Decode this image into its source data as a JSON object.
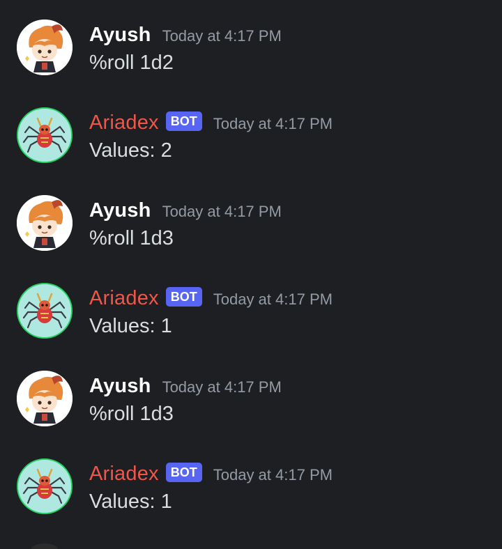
{
  "messages": [
    {
      "author": "Ayush",
      "is_bot": false,
      "timestamp": "Today at 4:17 PM",
      "content": "%roll 1d2"
    },
    {
      "author": "Ariadex",
      "is_bot": true,
      "bot_tag": "BOT",
      "timestamp": "Today at 4:17 PM",
      "content": "Values: 2"
    },
    {
      "author": "Ayush",
      "is_bot": false,
      "timestamp": "Today at 4:17 PM",
      "content": "%roll 1d3"
    },
    {
      "author": "Ariadex",
      "is_bot": true,
      "bot_tag": "BOT",
      "timestamp": "Today at 4:17 PM",
      "content": "Values: 1"
    },
    {
      "author": "Ayush",
      "is_bot": false,
      "timestamp": "Today at 4:17 PM",
      "content": "%roll 1d3"
    },
    {
      "author": "Ariadex",
      "is_bot": true,
      "bot_tag": "BOT",
      "timestamp": "Today at 4:17 PM",
      "content": "Values: 1"
    }
  ],
  "colors": {
    "background": "#1e1f22",
    "bot_name": "#f0564a",
    "bot_tag": "#5865f2",
    "timestamp": "#949ba4",
    "message_text": "#dbdee1"
  }
}
